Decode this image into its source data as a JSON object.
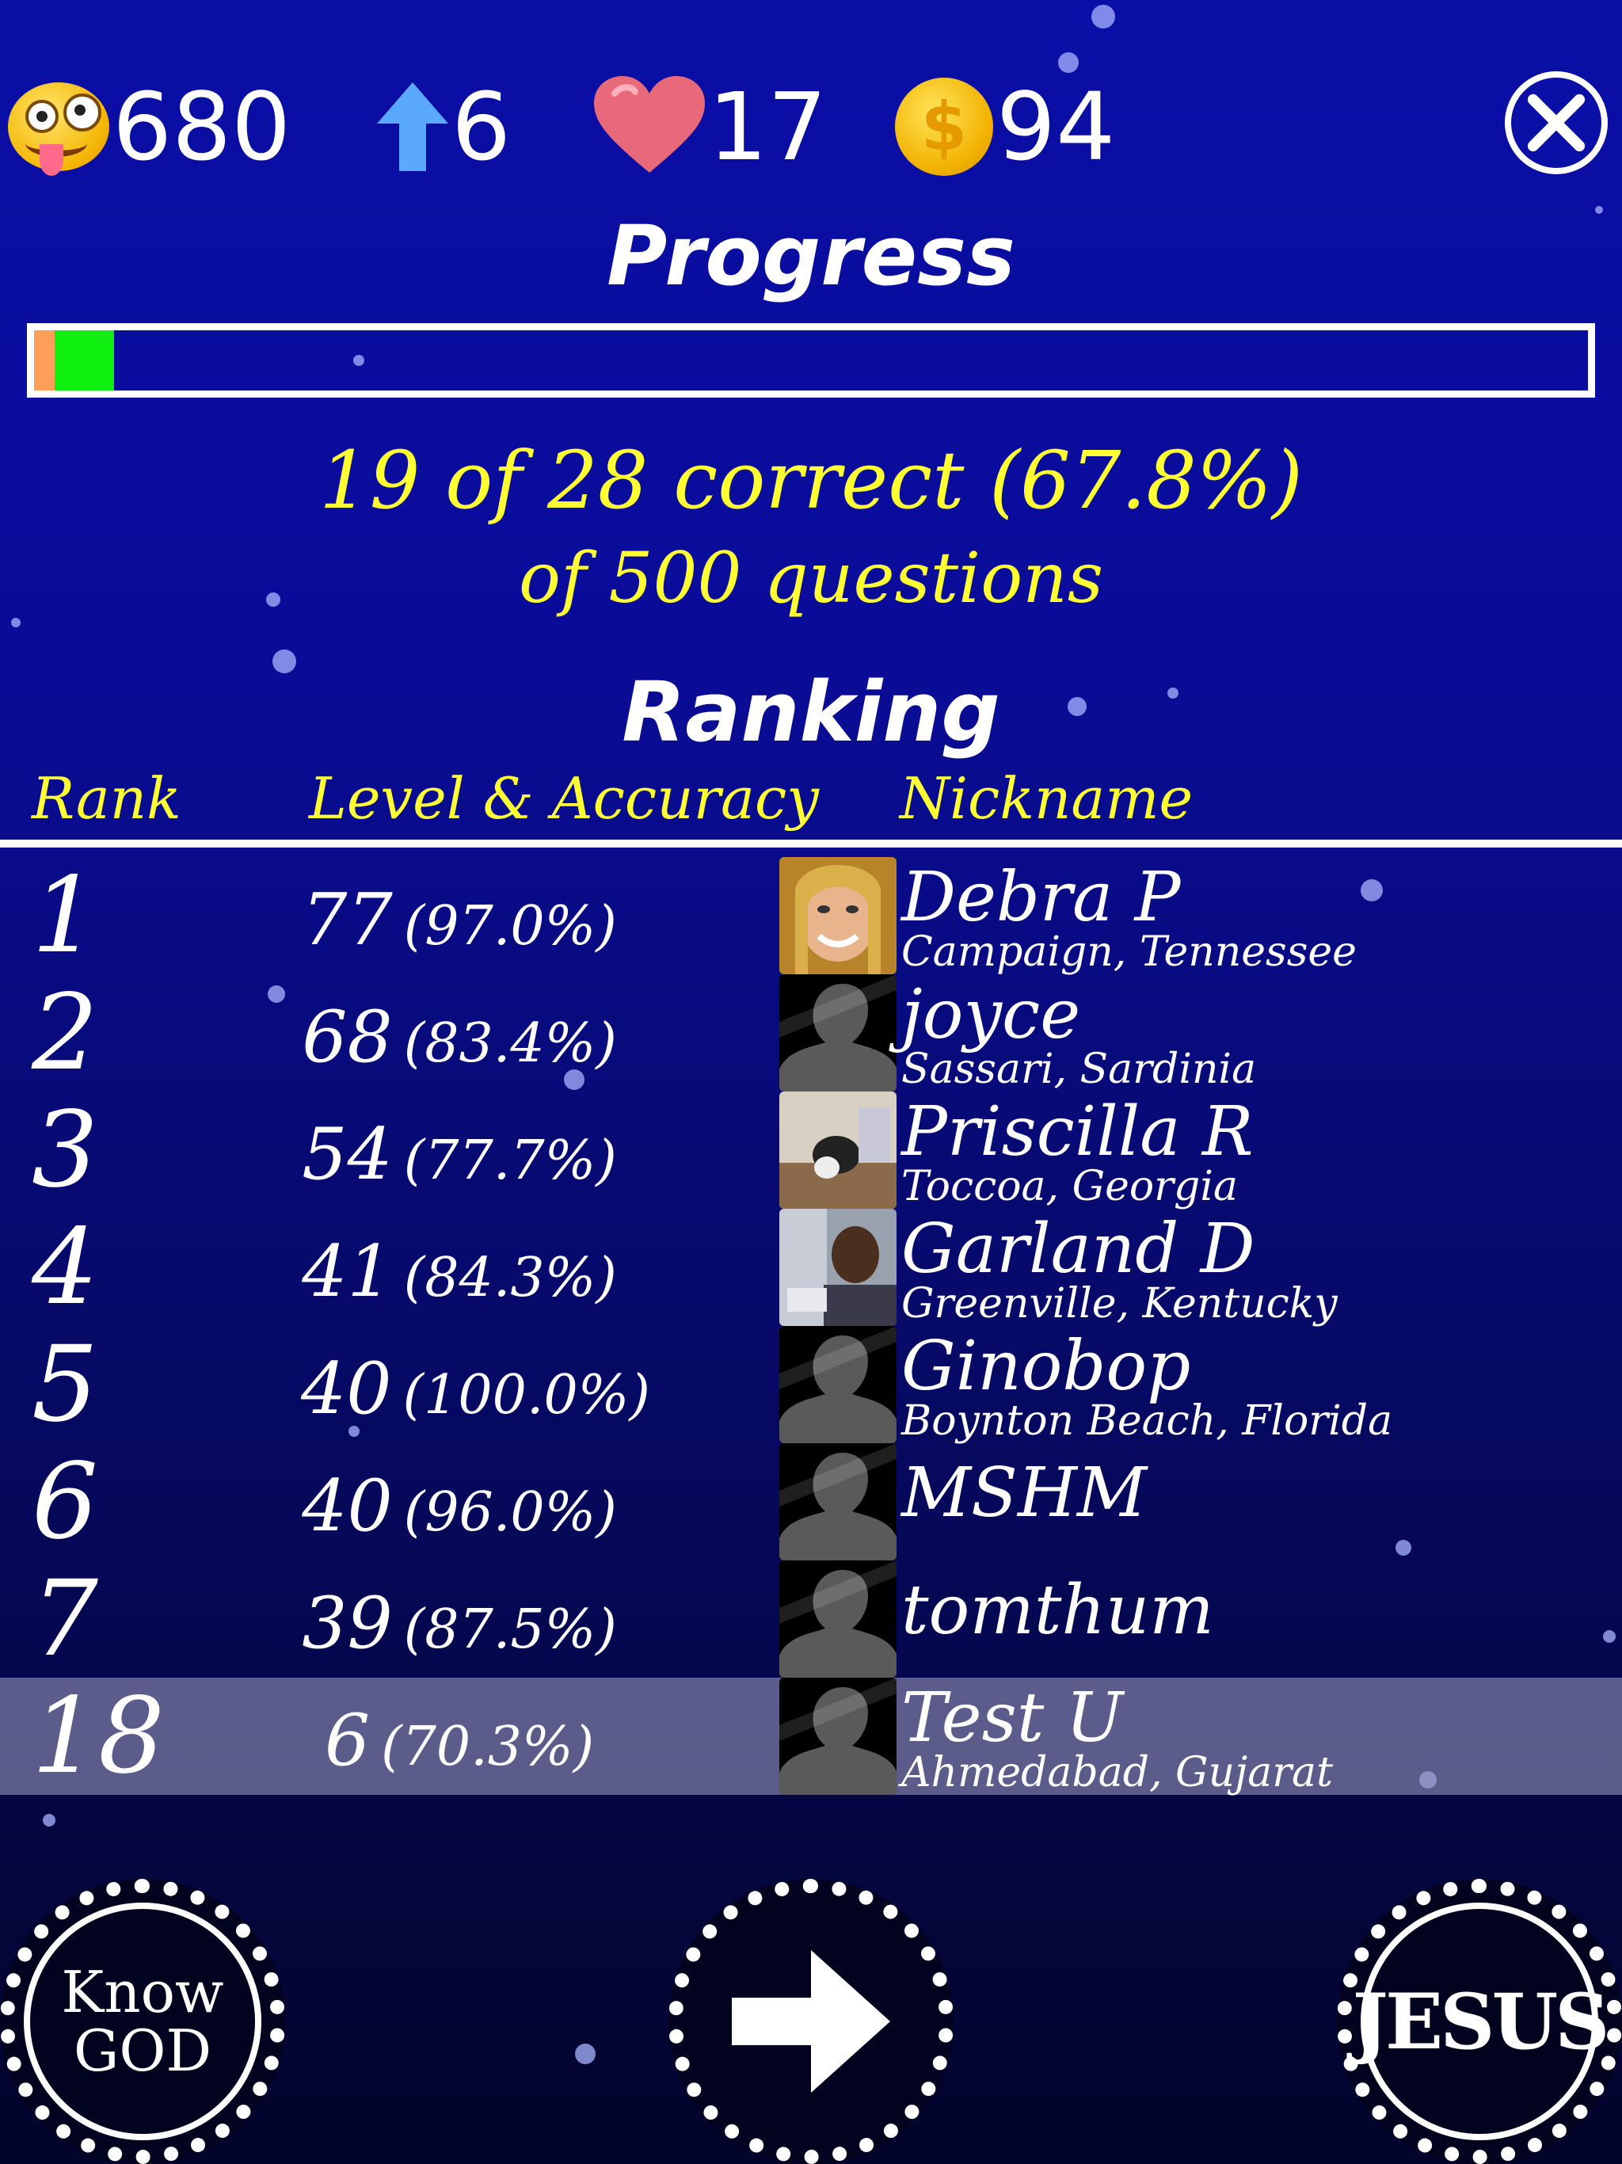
{
  "hud": {
    "score": "680",
    "level": "6",
    "lives": "17",
    "coins": "94",
    "icons": [
      "crazy-face-icon",
      "arrow-up-icon",
      "heart-icon",
      "dollar-coin-icon",
      "close-icon"
    ],
    "coin_symbol": "$"
  },
  "progress": {
    "title": "Progress",
    "wrong_fraction": 0.013,
    "correct_fraction": 0.038,
    "correct_color": "#10f010",
    "wrong_color": "#ff9f5a"
  },
  "stats": {
    "line1": "19 of 28 correct (67.8%)",
    "line2": "of 500 questions"
  },
  "ranking": {
    "title": "Ranking",
    "columns": {
      "rank": "Rank",
      "level": "Level & Accuracy",
      "nickname": "Nickname"
    },
    "rows": [
      {
        "rank": "1",
        "level": "77",
        "accuracy": "(97.0%)",
        "nickname": "Debra P",
        "location": "Campaign, Tennessee",
        "avatar": "photo-woman"
      },
      {
        "rank": "2",
        "level": "68",
        "accuracy": "(83.4%)",
        "nickname": "joyce",
        "location": "Sassari, Sardinia",
        "avatar": "default-silhouette"
      },
      {
        "rank": "3",
        "level": "54",
        "accuracy": "(77.7%)",
        "nickname": "Priscilla R",
        "location": "Toccoa, Georgia",
        "avatar": "photo-pet"
      },
      {
        "rank": "4",
        "level": "41",
        "accuracy": "(84.3%)",
        "nickname": "Garland D",
        "location": "Greenville, Kentucky",
        "avatar": "photo-man"
      },
      {
        "rank": "5",
        "level": "40",
        "accuracy": "(100.0%)",
        "nickname": "Ginobop",
        "location": "Boynton Beach, Florida",
        "avatar": "default-silhouette"
      },
      {
        "rank": "6",
        "level": "40",
        "accuracy": "(96.0%)",
        "nickname": "MSHM",
        "location": "",
        "avatar": "default-silhouette"
      },
      {
        "rank": "7",
        "level": "39",
        "accuracy": "(87.5%)",
        "nickname": "tomthum",
        "location": "",
        "avatar": "default-silhouette"
      },
      {
        "rank": "18",
        "level": "6",
        "accuracy": "(70.3%)",
        "nickname": "Test U",
        "location": "Ahmedabad, Gujarat",
        "avatar": "default-silhouette",
        "highlighted": true
      }
    ]
  },
  "footer": {
    "know_god_line1": "Know",
    "know_god_line2": "GOD",
    "jesus": "JESUS"
  }
}
